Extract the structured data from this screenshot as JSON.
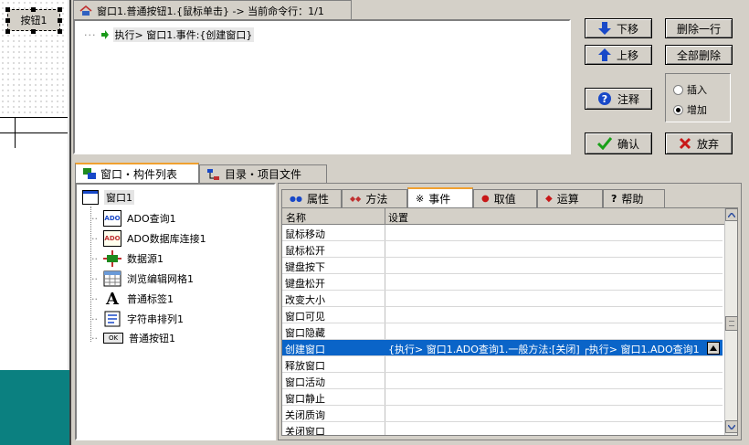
{
  "design": {
    "button_caption": "按钮1"
  },
  "title_tab": {
    "label": "窗口1.普通按钮1.{鼠标单击} -> 当前命令行：1/1"
  },
  "command": {
    "line": "执行> 窗口1.事件:{创建窗口}"
  },
  "buttons": {
    "move_down": "下移",
    "move_up": "上移",
    "delete_line": "删除一行",
    "delete_all": "全部删除",
    "comment": "注释",
    "confirm": "确认",
    "discard": "放弃"
  },
  "mode": {
    "insert": "插入",
    "append": "增加",
    "selected": "append"
  },
  "bottom_tabs": [
    "窗口・构件列表",
    "目录・项目文件"
  ],
  "tree": {
    "root": "窗口1",
    "items": [
      "ADO查询1",
      "ADO数据库连接1",
      "数据源1",
      "浏览编辑网格1",
      "普通标签1",
      "字符串排列1",
      "普通按钮1"
    ]
  },
  "prop_tabs": [
    "属性",
    "方法",
    "事件",
    "取值",
    "运算",
    "帮助"
  ],
  "grid": {
    "col_name": "名称",
    "col_setting": "设置",
    "rows": [
      {
        "name": "鼠标移动",
        "value": ""
      },
      {
        "name": "鼠标松开",
        "value": ""
      },
      {
        "name": "键盘按下",
        "value": ""
      },
      {
        "name": "键盘松开",
        "value": ""
      },
      {
        "name": "改变大小",
        "value": ""
      },
      {
        "name": "窗口可见",
        "value": ""
      },
      {
        "name": "窗口隐藏",
        "value": ""
      },
      {
        "name": "创建窗口",
        "value": "{执行> 窗口1.ADO查询1.一般方法:[关闭] ┌执行> 窗口1.ADO查询1"
      },
      {
        "name": "释放窗口",
        "value": ""
      },
      {
        "name": "窗口活动",
        "value": ""
      },
      {
        "name": "窗口静止",
        "value": ""
      },
      {
        "name": "关闭质询",
        "value": ""
      },
      {
        "name": "关闭窗口",
        "value": ""
      }
    ],
    "selected_index": 7
  },
  "colors": {
    "face": "#d4d0c8",
    "selection": "#0a64c8",
    "teal": "#0b8080",
    "tab_accent": "#f0a030"
  }
}
